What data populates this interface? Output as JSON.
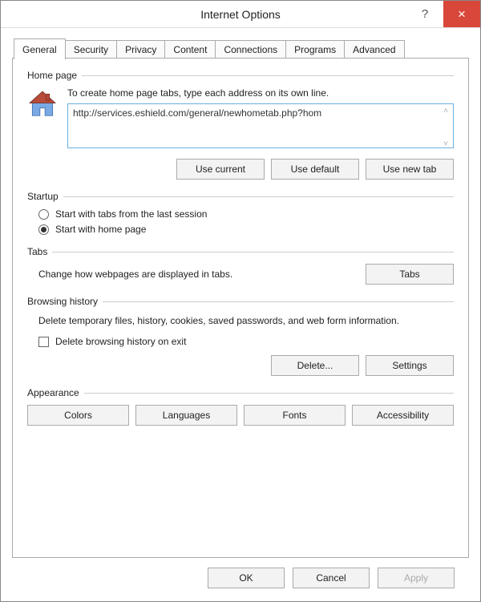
{
  "title": "Internet Options",
  "tabs": [
    "General",
    "Security",
    "Privacy",
    "Content",
    "Connections",
    "Programs",
    "Advanced"
  ],
  "homepage": {
    "label": "Home page",
    "instruction": "To create home page tabs, type each address on its own line.",
    "url": "http://services.eshield.com/general/newhometab.php?hom",
    "use_current": "Use current",
    "use_default": "Use default",
    "use_new_tab": "Use new tab"
  },
  "startup": {
    "label": "Startup",
    "opt_last": "Start with tabs from the last session",
    "opt_home": "Start with home page"
  },
  "tabs_section": {
    "label": "Tabs",
    "text": "Change how webpages are displayed in tabs.",
    "btn": "Tabs"
  },
  "history": {
    "label": "Browsing history",
    "text": "Delete temporary files, history, cookies, saved passwords, and web form information.",
    "checkbox": "Delete browsing history on exit",
    "delete": "Delete...",
    "settings": "Settings"
  },
  "appearance": {
    "label": "Appearance",
    "colors": "Colors",
    "languages": "Languages",
    "fonts": "Fonts",
    "accessibility": "Accessibility"
  },
  "buttons": {
    "ok": "OK",
    "cancel": "Cancel",
    "apply": "Apply"
  }
}
